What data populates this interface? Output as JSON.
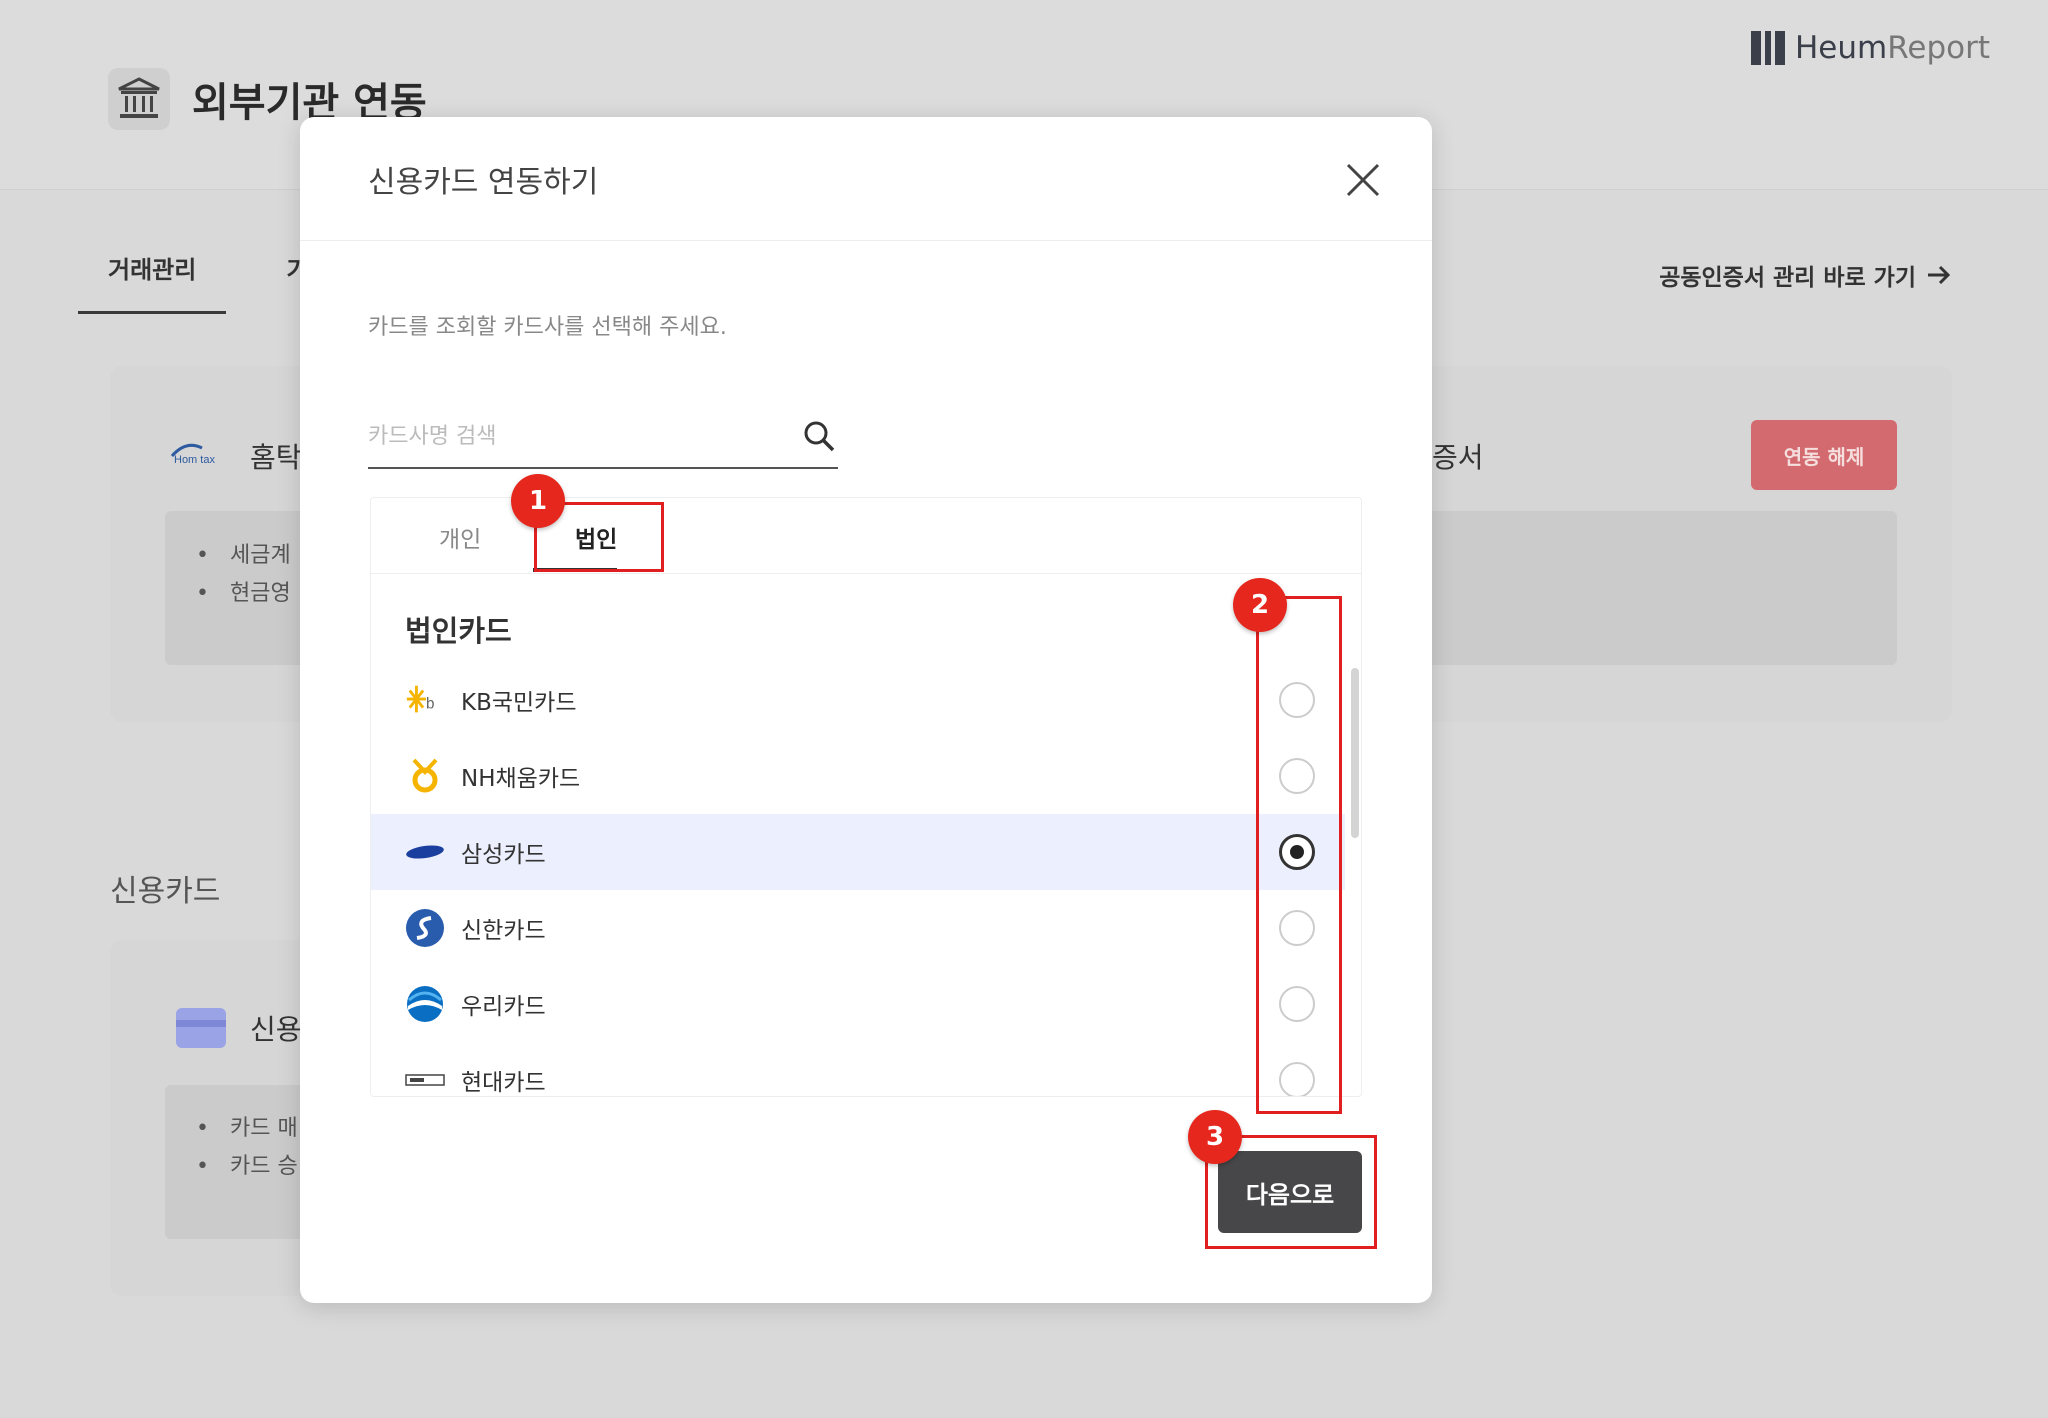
{
  "background": {
    "page_title": "외부기관 연동",
    "brand": {
      "bold": "Heum",
      "light": "Report"
    },
    "tabs": [
      {
        "label": "거래관리"
      },
      {
        "label": "기"
      }
    ],
    "cert_link": "공동인증서 관리 바로 가기",
    "hometax": {
      "name": "홈탁",
      "items": [
        "세금계",
        "현금영"
      ],
      "cert_suffix": "증서"
    },
    "release_button": "연동 해제",
    "credit_section": {
      "label": "신용카드",
      "card_title": "신용",
      "items": [
        "카드 매",
        "카드 승"
      ]
    }
  },
  "modal": {
    "title": "신용카드 연동하기",
    "instruction": "카드를 조회할 카드사를 선택해 주세요.",
    "search_placeholder": "카드사명 검색",
    "tabs": [
      {
        "label": "개인"
      },
      {
        "label": "법인"
      }
    ],
    "active_tab": "법인",
    "group_title": "법인카드",
    "cards": [
      {
        "name": "KB국민카드",
        "icon": "kb-logo-icon",
        "selected": false
      },
      {
        "name": "NH채움카드",
        "icon": "nh-logo-icon",
        "selected": false
      },
      {
        "name": "삼성카드",
        "icon": "samsung-logo-icon",
        "selected": true
      },
      {
        "name": "신한카드",
        "icon": "shinhan-logo-icon",
        "selected": false
      },
      {
        "name": "우리카드",
        "icon": "woori-logo-icon",
        "selected": false
      },
      {
        "name": "현대카드",
        "icon": "hyundai-logo-icon",
        "selected": false
      }
    ],
    "next_button": "다음으로"
  },
  "annotations": [
    "1",
    "2",
    "3"
  ],
  "colors": {
    "accent_red": "#e6271e",
    "selected_row": "#eceffd",
    "next_button": "#474749",
    "release_button": "#d36a6f"
  }
}
